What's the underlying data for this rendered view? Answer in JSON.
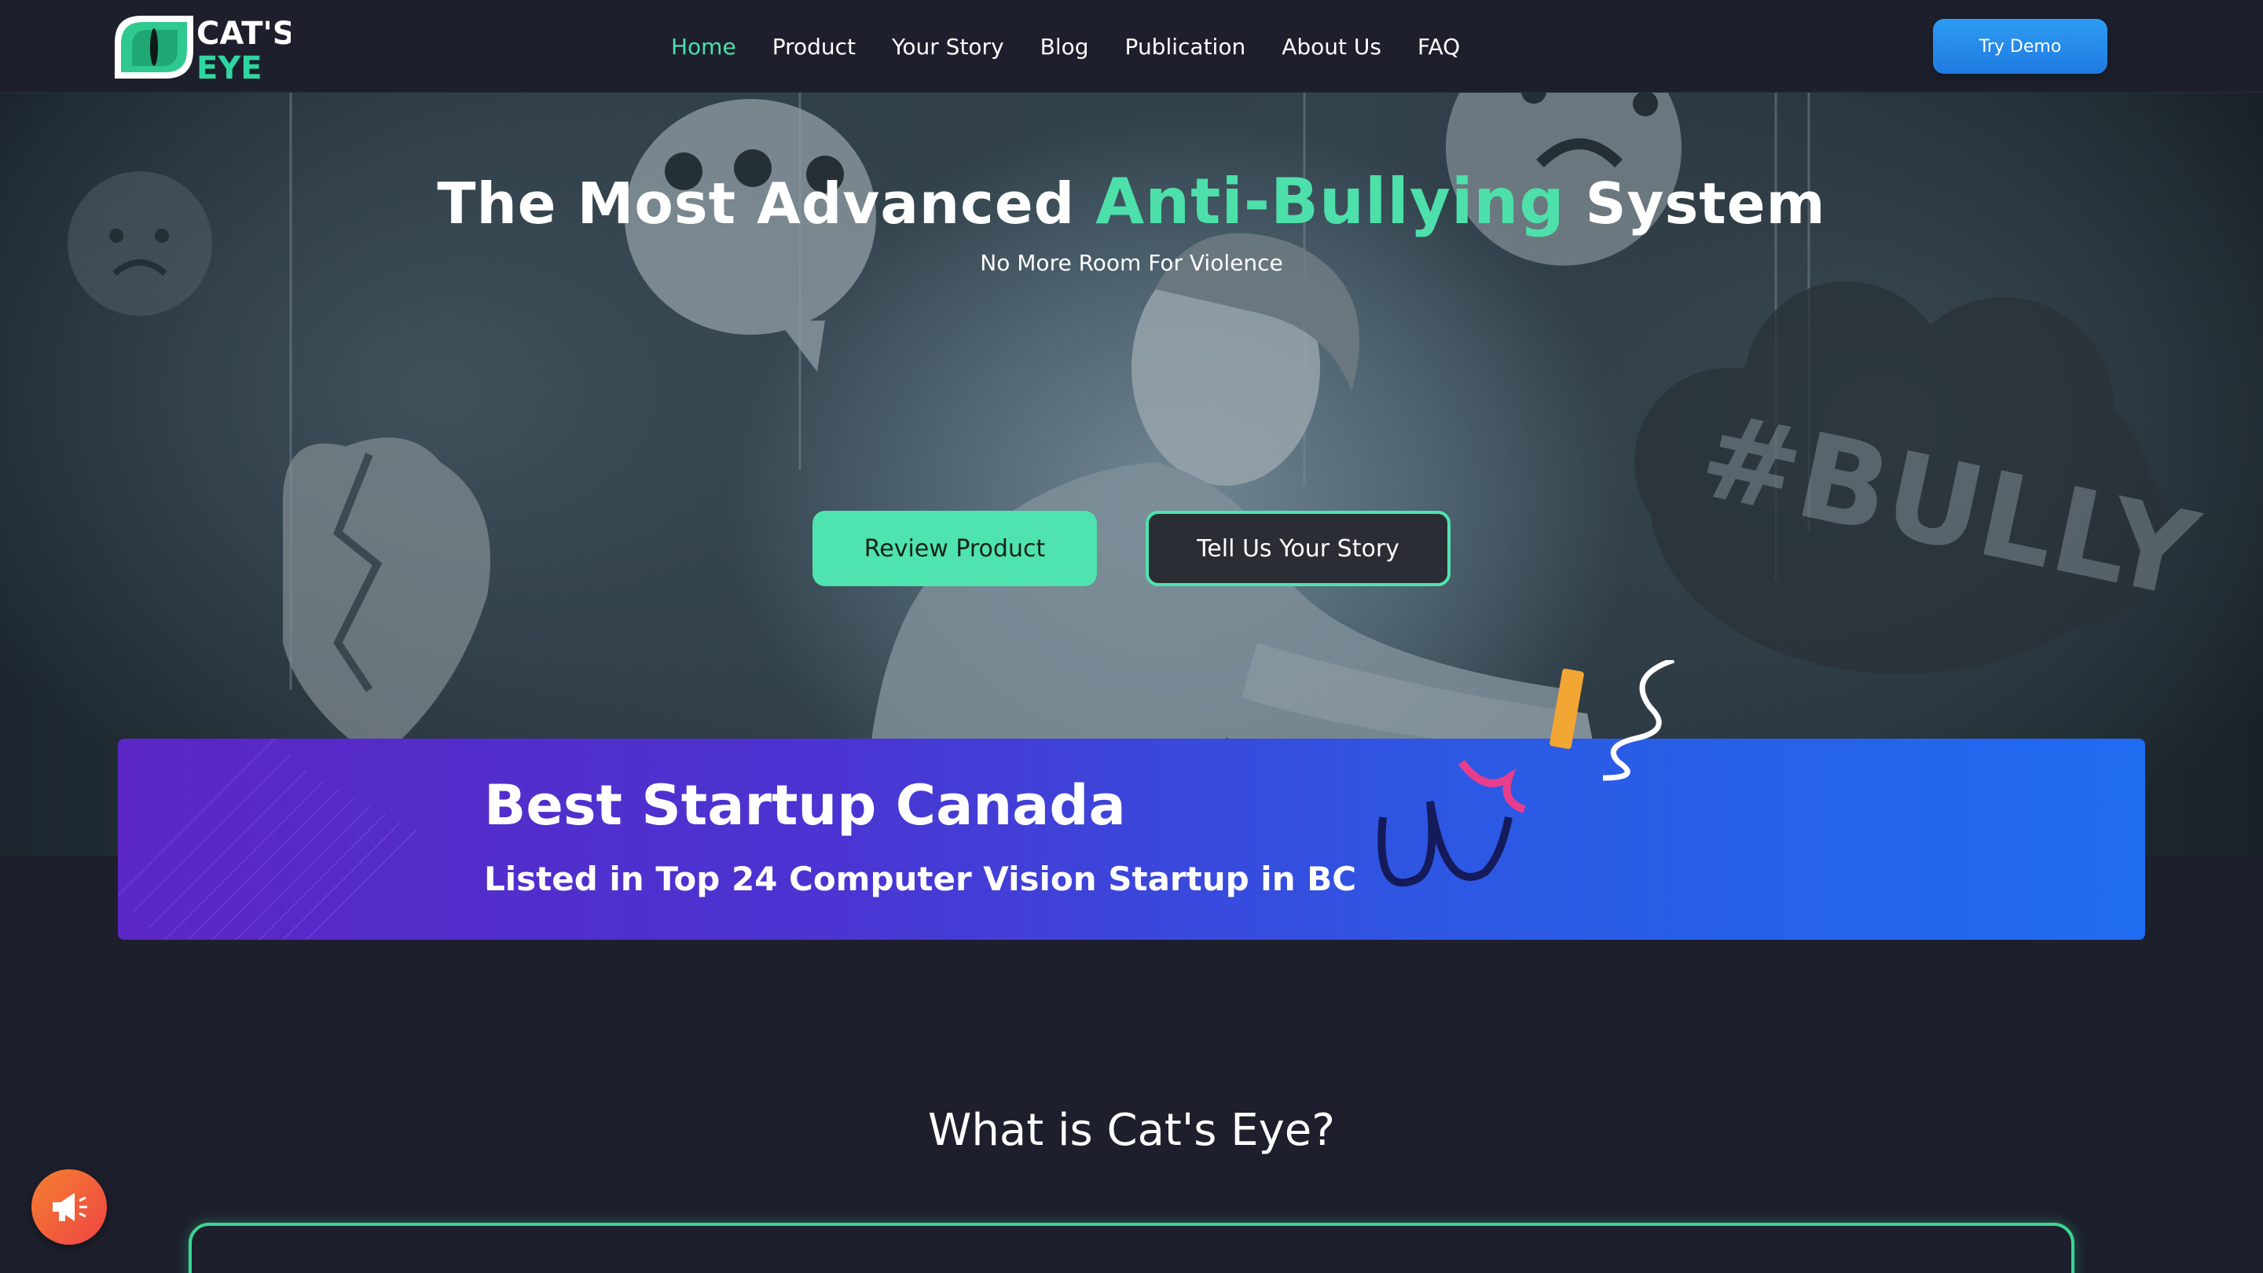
{
  "brand": {
    "logo_line1": "CAT'S",
    "logo_line2": "EYE",
    "accent_color": "#4de0aa"
  },
  "nav": {
    "items": [
      {
        "label": "Home",
        "active": true
      },
      {
        "label": "Product"
      },
      {
        "label": "Your Story"
      },
      {
        "label": "Blog"
      },
      {
        "label": "Publication"
      },
      {
        "label": "About Us"
      },
      {
        "label": "FAQ"
      }
    ],
    "cta": "Try Demo"
  },
  "hero": {
    "title_pre": "The Most Advanced ",
    "title_accent": "Anti-Bullying",
    "title_post": " System",
    "subtitle": "No More Room For Violence",
    "btn_primary": "Review Product",
    "btn_secondary": "Tell Us Your Story",
    "bubble_text": "#BULLY"
  },
  "banner": {
    "title": "Best Startup Canada",
    "subtitle": "Listed in Top 24 Computer Vision Startup in BC"
  },
  "section": {
    "title": "What is Cat's Eye?"
  },
  "widget": {
    "icon": "megaphone-icon"
  }
}
